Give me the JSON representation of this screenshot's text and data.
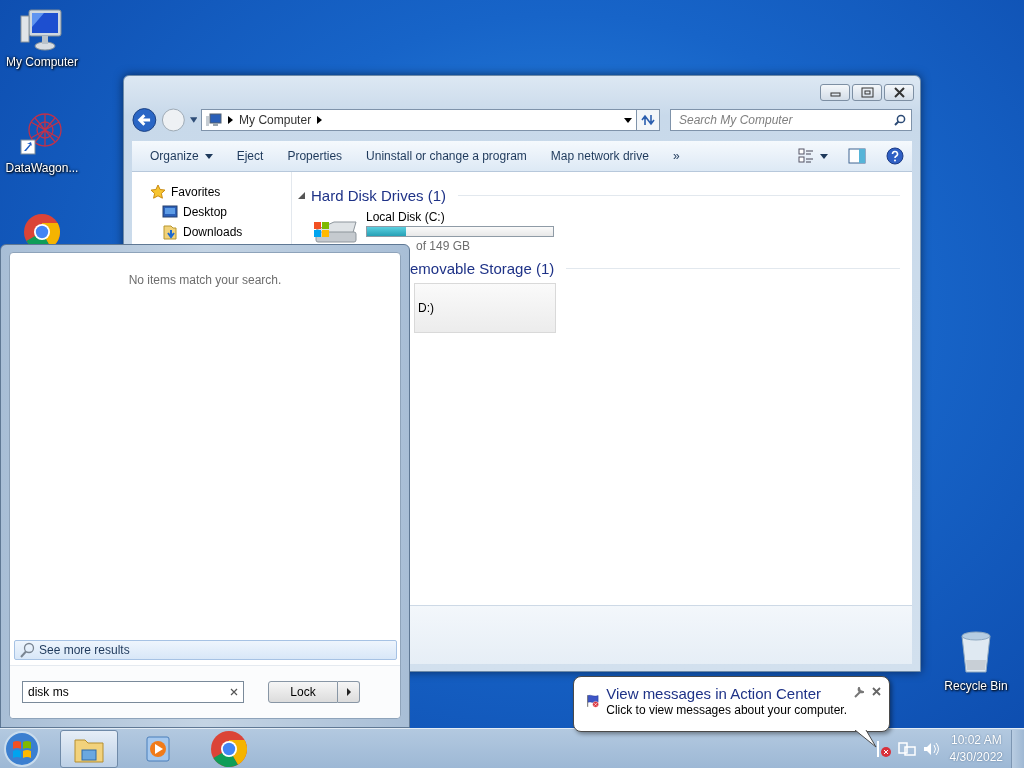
{
  "desktop_icons": [
    {
      "kind": "computer",
      "label": "My Computer"
    },
    {
      "kind": "network",
      "label": "DataWagon..."
    },
    {
      "kind": "chrome"
    },
    {
      "kind": "bin",
      "label": "Recycle Bin"
    }
  ],
  "explorer": {
    "address": [
      "My Computer"
    ],
    "search": {
      "placeholder": "Search My Computer"
    },
    "commands": [
      {
        "label": "Organize",
        "dropdown": true
      },
      {
        "label": "Eject",
        "dropdown": false
      },
      {
        "label": "Properties",
        "dropdown": false
      },
      {
        "label": "Uninstall or change a program",
        "dropdown": false
      },
      {
        "label": "Map network drive",
        "dropdown": false
      }
    ],
    "more": "»",
    "favorites": {
      "label": "Favorites",
      "items": [
        {
          "kind": "desktop",
          "label": "Desktop"
        },
        {
          "kind": "downloads",
          "label": "Downloads"
        }
      ]
    },
    "groups": [
      {
        "title": "Hard Disk Drives (1)",
        "cut": false,
        "drives": [
          {
            "kind": "disk",
            "name": "Local Disk (C:)",
            "level": 0.21,
            "free": "of 149 GB"
          }
        ]
      },
      {
        "title": "emovable Storage (1)",
        "cut": true,
        "drives": [
          {
            "kind": "removable",
            "name": "D:)"
          }
        ]
      }
    ]
  },
  "start_menu": {
    "message": "No items match your search.",
    "more": "See more results",
    "search": {
      "value": "disk ms"
    },
    "power": "Lock"
  },
  "balloon": {
    "title": "View messages in Action Center",
    "text": "Click to view messages about your computer."
  },
  "taskbar": {
    "apps": [
      {
        "kind": "explorer",
        "selected": true
      },
      {
        "kind": "media",
        "selected": false
      },
      {
        "kind": "chrome",
        "selected": false
      }
    ],
    "time": "10:02 AM",
    "date": "4/30/2022"
  }
}
